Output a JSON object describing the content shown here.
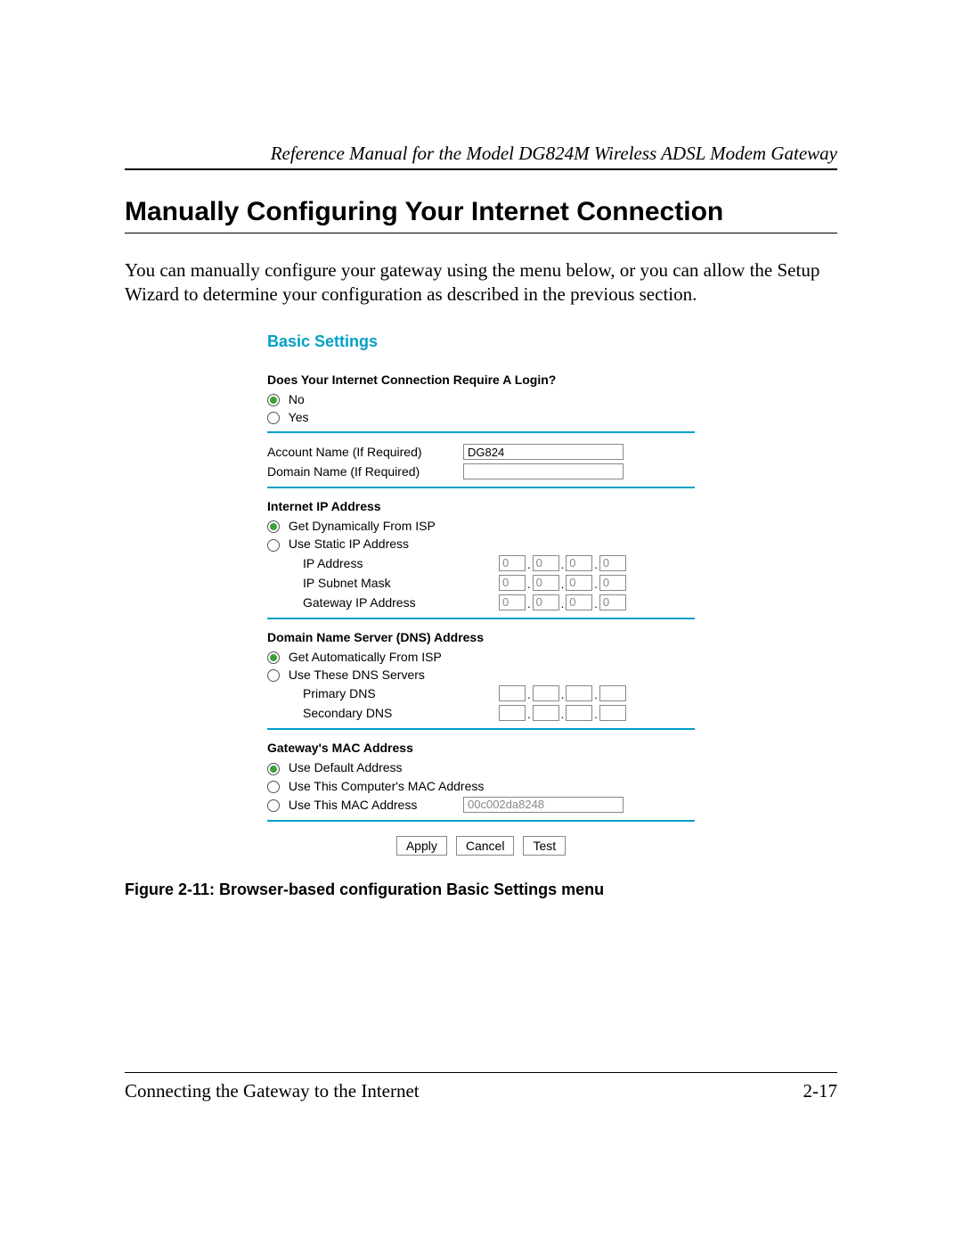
{
  "document": {
    "header_reference": "Reference Manual for the Model DG824M Wireless ADSL Modem Gateway",
    "section_heading": "Manually Configuring Your Internet Connection",
    "intro_paragraph": "You can manually configure your gateway using the menu below, or you can allow the Setup Wizard to determine your configuration as described in the previous section.",
    "figure_caption": "Figure 2-11: Browser-based configuration Basic Settings menu",
    "footer_chapter": "Connecting the Gateway to the Internet",
    "footer_page": "2-17"
  },
  "panel": {
    "title": "Basic Settings",
    "login_question": "Does Your Internet Connection Require A Login?",
    "login_options": {
      "no": "No",
      "yes": "Yes"
    },
    "login_selected": "no",
    "account_name_label": "Account Name  (If Required)",
    "account_name_value": "DG824",
    "domain_name_label": "Domain Name  (If Required)",
    "domain_name_value": "",
    "ip_heading": "Internet IP Address",
    "ip_dynamic": "Get Dynamically From ISP",
    "ip_static": "Use Static IP Address",
    "ip_selected": "dynamic",
    "ip_address_label": "IP Address",
    "ip_address": [
      "0",
      "0",
      "0",
      "0"
    ],
    "subnet_label": "IP Subnet Mask",
    "subnet": [
      "0",
      "0",
      "0",
      "0"
    ],
    "gw_label": "Gateway IP Address",
    "gw": [
      "0",
      "0",
      "0",
      "0"
    ],
    "dns_heading": "Domain Name Server (DNS) Address",
    "dns_auto": "Get Automatically From ISP",
    "dns_manual": "Use These DNS Servers",
    "dns_selected": "auto",
    "primary_dns_label": "Primary DNS",
    "primary_dns": [
      "",
      "",
      "",
      ""
    ],
    "secondary_dns_label": "Secondary DNS",
    "secondary_dns": [
      "",
      "",
      "",
      ""
    ],
    "mac_heading": "Gateway's MAC Address",
    "mac_default": "Use Default Address",
    "mac_computer": "Use This Computer's MAC Address",
    "mac_this": "Use This MAC Address",
    "mac_selected": "default",
    "mac_value": "00c002da8248",
    "buttons": {
      "apply": "Apply",
      "cancel": "Cancel",
      "test": "Test"
    }
  }
}
